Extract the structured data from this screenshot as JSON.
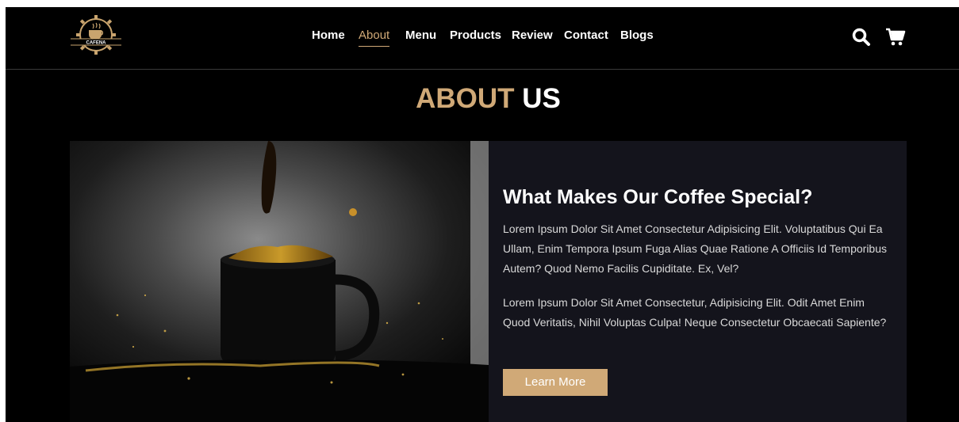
{
  "header": {
    "logo_text": "CAFENA",
    "nav": [
      {
        "label": "Home",
        "active": false
      },
      {
        "label": "About",
        "active": true
      },
      {
        "label": "Menu",
        "active": false
      },
      {
        "label": "Products",
        "active": false
      },
      {
        "label": "Review",
        "active": false
      },
      {
        "label": "Contact",
        "active": false
      },
      {
        "label": "Blogs",
        "active": false
      }
    ],
    "icons": [
      "search-icon",
      "cart-icon"
    ]
  },
  "section": {
    "title_accent": "ABOUT",
    "title_rest": "US",
    "heading": "What Makes Our Coffee Special?",
    "paragraph1": "Lorem Ipsum Dolor Sit Amet Consectetur Adipisicing Elit. Voluptatibus Qui Ea Ullam, Enim Tempora Ipsum Fuga Alias Quae Ratione A Officiis Id Temporibus Autem? Quod Nemo Facilis Cupiditate. Ex, Vel?",
    "paragraph2": "Lorem Ipsum Dolor Sit Amet Consectetur, Adipisicing Elit. Odit Amet Enim Quod Veritatis, Nihil Voluptas Culpa! Neque Consectetur Obcaecati Sapiente?",
    "button_label": "Learn More"
  },
  "colors": {
    "accent": "#d0a977",
    "background": "#000000",
    "panel": "#14141c"
  }
}
